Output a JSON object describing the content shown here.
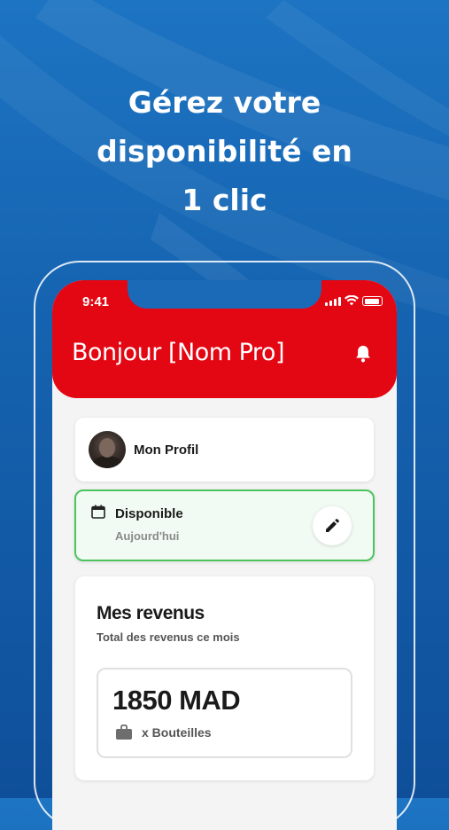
{
  "headline": {
    "line1": "Gérez votre",
    "line2": "disponibilité en",
    "line3": "1 clic"
  },
  "status_bar": {
    "time": "9:41",
    "icons": [
      "signal-icon",
      "wifi-icon",
      "battery-icon"
    ]
  },
  "header": {
    "greeting": "Bonjour [Nom Pro]",
    "icon": "bell-icon"
  },
  "profile": {
    "label": "Mon Profil",
    "icon": "avatar"
  },
  "availability": {
    "title": "Disponible",
    "subtitle": "Aujourd'hui",
    "icon": "calendar-icon",
    "action_icon": "pencil-icon"
  },
  "revenus": {
    "title": "Mes revenus",
    "subtitle": "Total des revenus ce mois",
    "amount": "1850 MAD",
    "detail": "x Bouteilles",
    "detail_icon": "briefcase-icon"
  },
  "colors": {
    "brand_red": "#e30613",
    "accent_green": "#4cc45e",
    "background_blue": "#1563b0"
  }
}
